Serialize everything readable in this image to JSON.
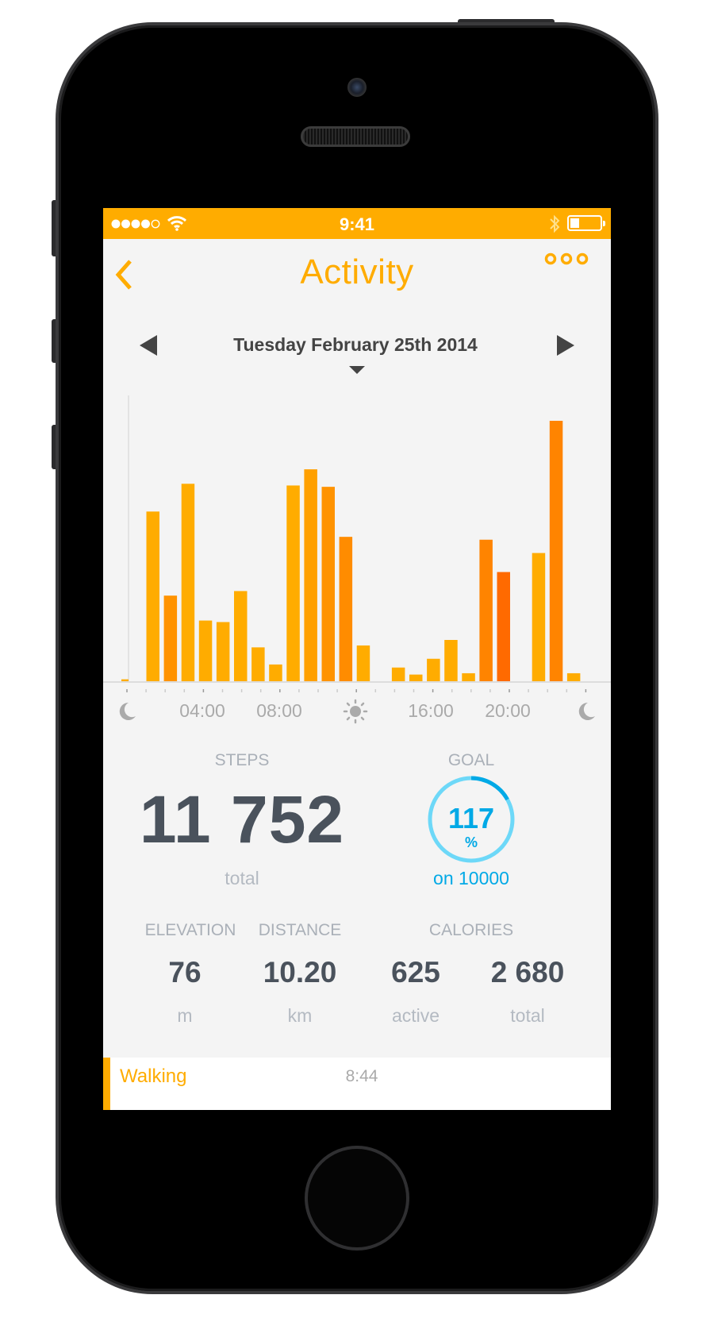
{
  "status_bar": {
    "time": "9:41",
    "signal_dots": 5,
    "signal_filled": 4,
    "battery_level": 0.3,
    "icons": [
      "signal-dots-icon",
      "wifi-icon",
      "bluetooth-icon",
      "battery-icon"
    ]
  },
  "header": {
    "title": "Activity",
    "back_icon": "chevron-left-icon",
    "more_icon": "more-dots-icon"
  },
  "date_nav": {
    "date": "Tuesday February 25th 2014",
    "prev_icon": "triangle-left-icon",
    "next_icon": "triangle-right-icon",
    "dropdown_icon": "triangle-down-icon"
  },
  "chart_data": {
    "type": "bar",
    "title": "",
    "xlabel": "",
    "ylabel": "",
    "x_tick_labels": [
      "04:00",
      "08:00",
      "16:00",
      "20:00"
    ],
    "x_tick_icons": [
      "moon-icon",
      "sun-icon",
      "moon-icon"
    ],
    "values": [
      10,
      892,
      450,
      1038,
      319,
      311,
      474,
      178,
      88,
      1029,
      1114,
      1022,
      759,
      188,
      0,
      72,
      35,
      118,
      217,
      42,
      744,
      574,
      0,
      674,
      1369,
      42
    ],
    "colors": [
      "#FFAC00",
      "#FFAC00",
      "#FF9300",
      "#FFAC00",
      "#FFAC00",
      "#FFAC00",
      "#FFAC00",
      "#FFAC00",
      "#FFAC00",
      "#FFAC00",
      "#FFA000",
      "#FF9300",
      "#FF8C00",
      "#FFAC00",
      "#FFAC00",
      "#FFAC00",
      "#FFAC00",
      "#FFAC00",
      "#FFAC00",
      "#FFAC00",
      "#FF8400",
      "#FF6A00",
      "#FFAC00",
      "#FFAC00",
      "#FF8400",
      "#FFAC00"
    ],
    "grid": false
  },
  "steps": {
    "label": "STEPS",
    "value": "11 752",
    "unit": "total"
  },
  "goal": {
    "label": "GOAL",
    "percent": "117",
    "percent_sign": "%",
    "target": "on 10000",
    "progress": 1.17,
    "ring_color": "#6DD8F8",
    "accent_color": "#00A9E6"
  },
  "stats": [
    {
      "label": "ELEVATION",
      "value": "76",
      "unit": "m"
    },
    {
      "label": "DISTANCE",
      "value": "10.20",
      "unit": "km"
    },
    {
      "label": "CALORIES",
      "value": "625",
      "unit": "active"
    },
    {
      "value": "2 680",
      "unit": "total"
    }
  ],
  "activity_list": [
    {
      "name": "Walking",
      "time": "8:44"
    }
  ],
  "colors": {
    "accent": "#FFAC00",
    "text_dark": "#4A525C",
    "blue": "#00A9E6"
  }
}
